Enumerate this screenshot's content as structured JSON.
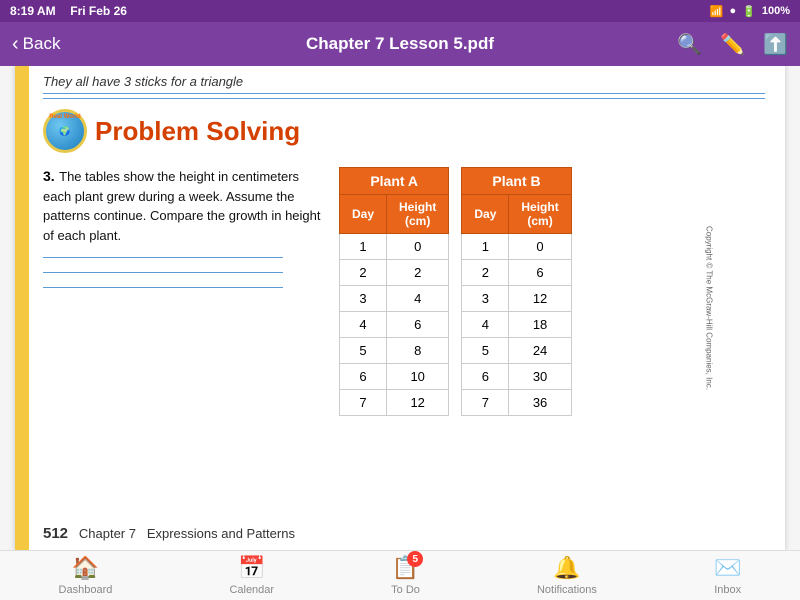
{
  "statusBar": {
    "time": "8:19 AM",
    "date": "Fri Feb 26",
    "battery": "100%"
  },
  "navBar": {
    "backLabel": "Back",
    "title": "Chapter 7 Lesson 5.pdf"
  },
  "page": {
    "cutoffText": "They all have 3 sticks for a triangle",
    "sectionTitle": "Problem Solving",
    "globeLabel": "Real World",
    "problemNumber": "3.",
    "problemText": "The tables show the height in centimeters each plant grew during a week. Assume the patterns continue. Compare the growth in height of each plant.",
    "plantATitle": "Plant A",
    "plantBTitle": "Plant B",
    "colDay": "Day",
    "colHeight": "Height (cm)",
    "plantAData": [
      {
        "day": "1",
        "height": "0"
      },
      {
        "day": "2",
        "height": "2"
      },
      {
        "day": "3",
        "height": "4"
      },
      {
        "day": "4",
        "height": "6"
      },
      {
        "day": "5",
        "height": "8"
      },
      {
        "day": "6",
        "height": "10"
      },
      {
        "day": "7",
        "height": "12"
      }
    ],
    "plantBData": [
      {
        "day": "1",
        "height": "0"
      },
      {
        "day": "2",
        "height": "6"
      },
      {
        "day": "3",
        "height": "12"
      },
      {
        "day": "4",
        "height": "18"
      },
      {
        "day": "5",
        "height": "24"
      },
      {
        "day": "6",
        "height": "30"
      },
      {
        "day": "7",
        "height": "36"
      }
    ],
    "footerPageNum": "512",
    "footerChapter": "Chapter 7",
    "footerTitle": "Expressions and Patterns",
    "copyright": "Copyright © The McGraw-Hill Companies, Inc."
  },
  "tabBar": {
    "tabs": [
      {
        "id": "dashboard",
        "label": "Dashboard",
        "icon": "🏠",
        "active": false
      },
      {
        "id": "calendar",
        "label": "Calendar",
        "icon": "📅",
        "active": false
      },
      {
        "id": "todo",
        "label": "To Do",
        "icon": "📋",
        "active": false,
        "badge": "5"
      },
      {
        "id": "notifications",
        "label": "Notifications",
        "icon": "🔔",
        "active": false
      },
      {
        "id": "inbox",
        "label": "Inbox",
        "icon": "✉️",
        "active": false
      }
    ]
  }
}
